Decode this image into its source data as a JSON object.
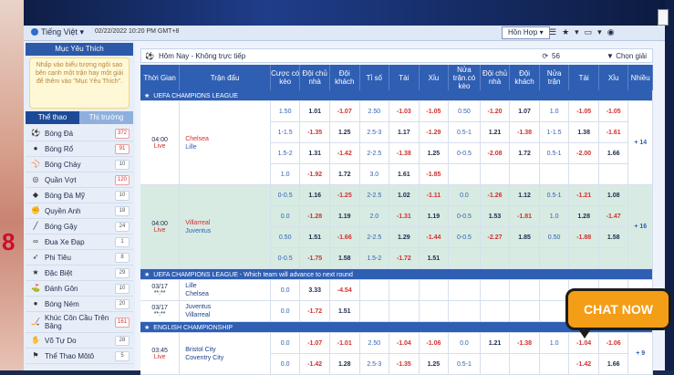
{
  "topbar": {
    "language": "Tiếng Việt",
    "datetime": "02/22/2022 10:20 PM GMT+8",
    "odds_type": "Hồn Hợp"
  },
  "sidebar": {
    "favorites_title": "Mục Yêu Thích",
    "favorites_hint": "Nhấp vào biểu tượng ngôi sao bên cạnh một trận hay một giải để thêm vào \"Mục Yêu Thích\".",
    "tab_sports": "Thể thao",
    "tab_market": "Thị trường",
    "sports": [
      {
        "name": "Bóng Đá",
        "count": "372",
        "icon": "soccer-icon",
        "glyph": "⚽",
        "red": true
      },
      {
        "name": "Bóng Rổ",
        "count": "91",
        "icon": "basketball-icon",
        "glyph": "●",
        "red": true
      },
      {
        "name": "Bóng Chày",
        "count": "10",
        "icon": "baseball-icon",
        "glyph": "⚾",
        "red": false
      },
      {
        "name": "Quần Vợt",
        "count": "120",
        "icon": "tennis-icon",
        "glyph": "◎",
        "red": true
      },
      {
        "name": "Bóng Đá Mỹ",
        "count": "10",
        "icon": "american-football-icon",
        "glyph": "◆",
        "red": false
      },
      {
        "name": "Quyền Anh",
        "count": "18",
        "icon": "boxing-icon",
        "glyph": "✊",
        "red": false
      },
      {
        "name": "Bóng Gậy",
        "count": "24",
        "icon": "cricket-icon",
        "glyph": "╱",
        "red": false
      },
      {
        "name": "Đua Xe Đạp",
        "count": "1",
        "icon": "cycling-icon",
        "glyph": "∞",
        "red": false
      },
      {
        "name": "Phi Tiêu",
        "count": "8",
        "icon": "darts-icon",
        "glyph": "➶",
        "red": false
      },
      {
        "name": "Đặc Biệt",
        "count": "29",
        "icon": "special-icon",
        "glyph": "★",
        "red": false
      },
      {
        "name": "Đánh Gôn",
        "count": "10",
        "icon": "golf-icon",
        "glyph": "⛳",
        "red": false
      },
      {
        "name": "Bóng Ném",
        "count": "20",
        "icon": "handball-icon",
        "glyph": "●",
        "red": false
      },
      {
        "name": "Khúc Côn Cầu Trên Băng",
        "count": "161",
        "icon": "ice-hockey-icon",
        "glyph": "🏒",
        "red": true
      },
      {
        "name": "Võ Tự Do",
        "count": "28",
        "icon": "mma-icon",
        "glyph": "✋",
        "red": false
      },
      {
        "name": "Thể Thao Môtô",
        "count": "5",
        "icon": "motorsport-icon",
        "glyph": "⚑",
        "red": false
      }
    ]
  },
  "main": {
    "title": "Hôm Nay - Không trực tiếp",
    "count": "56",
    "filter_label": "Chọn giải",
    "headers": [
      "Thời Gian",
      "Trận đấu",
      "Cược có kèo",
      "Đội chủ nhà",
      "Đội khách",
      "Tỉ số",
      "Tài",
      "Xỉu",
      "Nửa trận.có kèo",
      "Đội chủ nhà",
      "Đội khách",
      "Nửa trận",
      "Tài",
      "Xỉu",
      "Nhiều"
    ],
    "leagues": [
      {
        "name": "UEFA CHAMPIONS LEAGUE",
        "matches": [
          {
            "style": "a",
            "time": "04:00",
            "status": "Live",
            "home": "Chelsea",
            "away": "Lille",
            "more": "+ 14",
            "rows": [
              [
                "1.50",
                "1.01",
                "-1.07",
                "2.50",
                "-1.03",
                "-1.05",
                "0.50",
                "-1.20",
                "1.07",
                "1.0",
                "-1.05",
                "-1.05"
              ],
              [
                "1-1.5",
                "-1.35",
                "1.25",
                "2.5-3",
                "1.17",
                "-1.29",
                "0.5-1",
                "1.21",
                "-1.38",
                "1-1.5",
                "1.38",
                "-1.61"
              ],
              [
                "1.5-2",
                "1.31",
                "-1.42",
                "2-2.5",
                "-1.38",
                "1.25",
                "0-0.5",
                "-2.08",
                "1.72",
                "0.5-1",
                "-2.00",
                "1.66"
              ],
              [
                "1.0",
                "-1.92",
                "1.72",
                "3.0",
                "1.61",
                "-1.85",
                "",
                "",
                "",
                "",
                "",
                ""
              ]
            ]
          },
          {
            "style": "b",
            "time": "04:00",
            "status": "Live",
            "home": "Villarreal",
            "away": "Juventus",
            "more": "+ 16",
            "rows": [
              [
                "0-0.5",
                "1.16",
                "-1.25",
                "2-2.5",
                "1.02",
                "-1.11",
                "0.0",
                "-1.26",
                "1.12",
                "0.5-1",
                "-1.21",
                "1.08"
              ],
              [
                "0.0",
                "-1.28",
                "1.19",
                "2.0",
                "-1.31",
                "1.19",
                "0-0.5",
                "1.53",
                "-1.81",
                "1.0",
                "1.28",
                "-1.47"
              ],
              [
                "0.50",
                "1.51",
                "-1.66",
                "2-2.5",
                "1.29",
                "-1.44",
                "0-0.5",
                "-2.27",
                "1.85",
                "0.50",
                "-1.88",
                "1.58"
              ],
              [
                "0-0.5",
                "-1.75",
                "1.58",
                "1.5-2",
                "-1.72",
                "1.51",
                "",
                "",
                "",
                "",
                "",
                ""
              ]
            ]
          }
        ]
      },
      {
        "name": "UEFA CHAMPIONS LEAGUE - Which team will advance to next round",
        "matches": [
          {
            "style": "a",
            "time": "03/17",
            "status": "**:**",
            "home": "Lille",
            "away": "Chelsea",
            "more": "",
            "rows": [
              [
                "0.0",
                "3.33",
                "-4.54",
                "",
                "",
                "",
                "",
                "",
                "",
                "",
                "",
                ""
              ]
            ]
          },
          {
            "style": "a",
            "time": "03/17",
            "status": "**:**",
            "home": "Juventus",
            "away": "Villarreal",
            "more": "",
            "rows": [
              [
                "0.0",
                "-1.72",
                "1.51",
                "",
                "",
                "",
                "",
                "",
                "",
                "",
                "",
                ""
              ]
            ]
          }
        ]
      },
      {
        "name": "ENGLISH CHAMPIONSHIP",
        "matches": [
          {
            "style": "a",
            "time": "03:45",
            "status": "Live",
            "home": "Bristol City",
            "away": "Coventry City",
            "more": "+ 9",
            "rows": [
              [
                "0.0",
                "-1.07",
                "-1.01",
                "2.50",
                "-1.04",
                "-1.06",
                "0.0",
                "1.21",
                "-1.38",
                "1.0",
                "-1.04",
                "-1.06"
              ],
              [
                "0.0",
                "-1.42",
                "1.28",
                "2.5-3",
                "-1.35",
                "1.25",
                "0.5-1",
                "",
                "",
                "",
                "-1.42",
                "1.66"
              ]
            ]
          }
        ]
      }
    ]
  },
  "chat_button": "CHAT NOW"
}
